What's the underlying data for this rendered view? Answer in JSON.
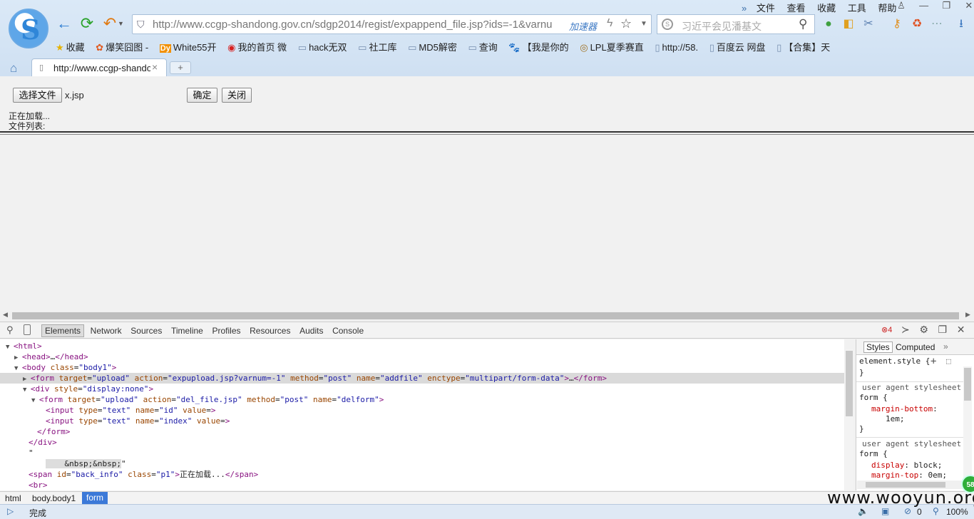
{
  "menu": [
    "文件",
    "查看",
    "收藏",
    "工具",
    "帮助"
  ],
  "address": {
    "url": "http://www.ccgp-shandong.gov.cn/sdgp2014/regist/expappend_file.jsp?ids=-1&varnu",
    "accelerator": "加速器"
  },
  "search": {
    "placeholder": "习近平会见潘基文"
  },
  "favorites": [
    {
      "icon": "★",
      "label": "收藏"
    },
    {
      "icon": "✿",
      "label": "爆笑囧图 -"
    },
    {
      "icon": "Dy",
      "label": "White55开"
    },
    {
      "icon": "◉",
      "label": "我的首页 微"
    },
    {
      "icon": "▭",
      "label": "hack无双"
    },
    {
      "icon": "▭",
      "label": "社工库"
    },
    {
      "icon": "▭",
      "label": "MD5解密"
    },
    {
      "icon": "▭",
      "label": "查询"
    },
    {
      "icon": "🐾",
      "label": "【我是你的"
    },
    {
      "icon": "◎",
      "label": "LPL夏季赛直"
    },
    {
      "icon": "▯",
      "label": "http://58."
    },
    {
      "icon": "▯",
      "label": "百度云 网盘"
    },
    {
      "icon": "▯",
      "label": "【合集】天"
    }
  ],
  "tab": {
    "title": "http://www.ccgp-shandong.gov.cn",
    "new_tab": "+"
  },
  "page": {
    "choose_file": "选择文件",
    "file_name": "x.jsp",
    "confirm": "确定",
    "close": "关闭",
    "loading": "正在加载...",
    "file_list": "文件列表:"
  },
  "devtools": {
    "tabs": [
      "Elements",
      "Network",
      "Sources",
      "Timeline",
      "Profiles",
      "Resources",
      "Audits",
      "Console"
    ],
    "errors": "4",
    "styles_tab": "Styles",
    "computed_tab": "Computed",
    "breadcrumbs": [
      "html",
      "body.body1",
      "form"
    ]
  },
  "dom_lines": [
    {
      "tri": "▼",
      "tag": "<html>"
    },
    {
      "tri": "▶",
      "tag": "<head>",
      "text": "…",
      "close": "</head>"
    },
    {
      "tri": "▼",
      "tag": "<body",
      "attrs": [
        {
          "n": "class",
          "v": "\"body1\""
        }
      ],
      "end": ">"
    },
    {
      "tri": "▶",
      "tag": "<form",
      "attrs": [
        {
          "n": "target",
          "v": "\"upload\""
        },
        {
          "n": "action",
          "v": "\"expupload.jsp?varnum=-1\""
        },
        {
          "n": "method",
          "v": "\"post\""
        },
        {
          "n": "name",
          "v": "\"addfile\""
        },
        {
          "n": "enctype",
          "v": "\"multipart/form-data\""
        }
      ],
      "end": ">",
      "text": "…",
      "close": "</form>"
    },
    {
      "tri": "▼",
      "tag": "<div",
      "attrs": [
        {
          "n": "style",
          "v": "\"display:none\""
        }
      ],
      "end": ">"
    },
    {
      "tri": "▼",
      "tag": "<form",
      "attrs": [
        {
          "n": "target",
          "v": "\"upload\""
        },
        {
          "n": "action",
          "v": "\"del_file.jsp\""
        },
        {
          "n": "method",
          "v": "\"post\""
        },
        {
          "n": "name",
          "v": "\"delform\""
        }
      ],
      "end": ">"
    },
    {
      "tag": "<input",
      "attrs": [
        {
          "n": "type",
          "v": "\"text\""
        },
        {
          "n": "name",
          "v": "\"id\""
        },
        {
          "n": "value",
          "v": ""
        }
      ],
      "end": ">"
    },
    {
      "tag": "<input",
      "attrs": [
        {
          "n": "type",
          "v": "\"text\""
        },
        {
          "n": "name",
          "v": "\"index\""
        },
        {
          "n": "value",
          "v": ""
        }
      ],
      "end": ">"
    },
    {
      "tag": "</form>"
    },
    {
      "tag": "</div>"
    },
    {
      "text": "\""
    },
    {
      "text": "&nbsp;&nbsp;",
      "text2": "\""
    },
    {
      "tag": "<span",
      "attrs": [
        {
          "n": "id",
          "v": "\"back_info\""
        },
        {
          "n": "class",
          "v": "\"p1\""
        }
      ],
      "end": ">",
      "text": "正在加载...",
      "close": "</span>"
    },
    {
      "tag": "<br>"
    }
  ],
  "styles": {
    "element_style": "element.style {",
    "close_brace": "}",
    "ua_label": "user agent stylesheet",
    "form_selector": "form {",
    "rule1_prop": "margin-bottom",
    "rule1_val": "1em;",
    "rule2_prop1": "display",
    "rule2_val1": "block;",
    "rule2_prop2": "margin-top",
    "rule2_val2": "0em;"
  },
  "status": {
    "text": "完成",
    "zoom": "100%",
    "count": "0",
    "badge": "58"
  },
  "watermark": "www.wooyun.org"
}
